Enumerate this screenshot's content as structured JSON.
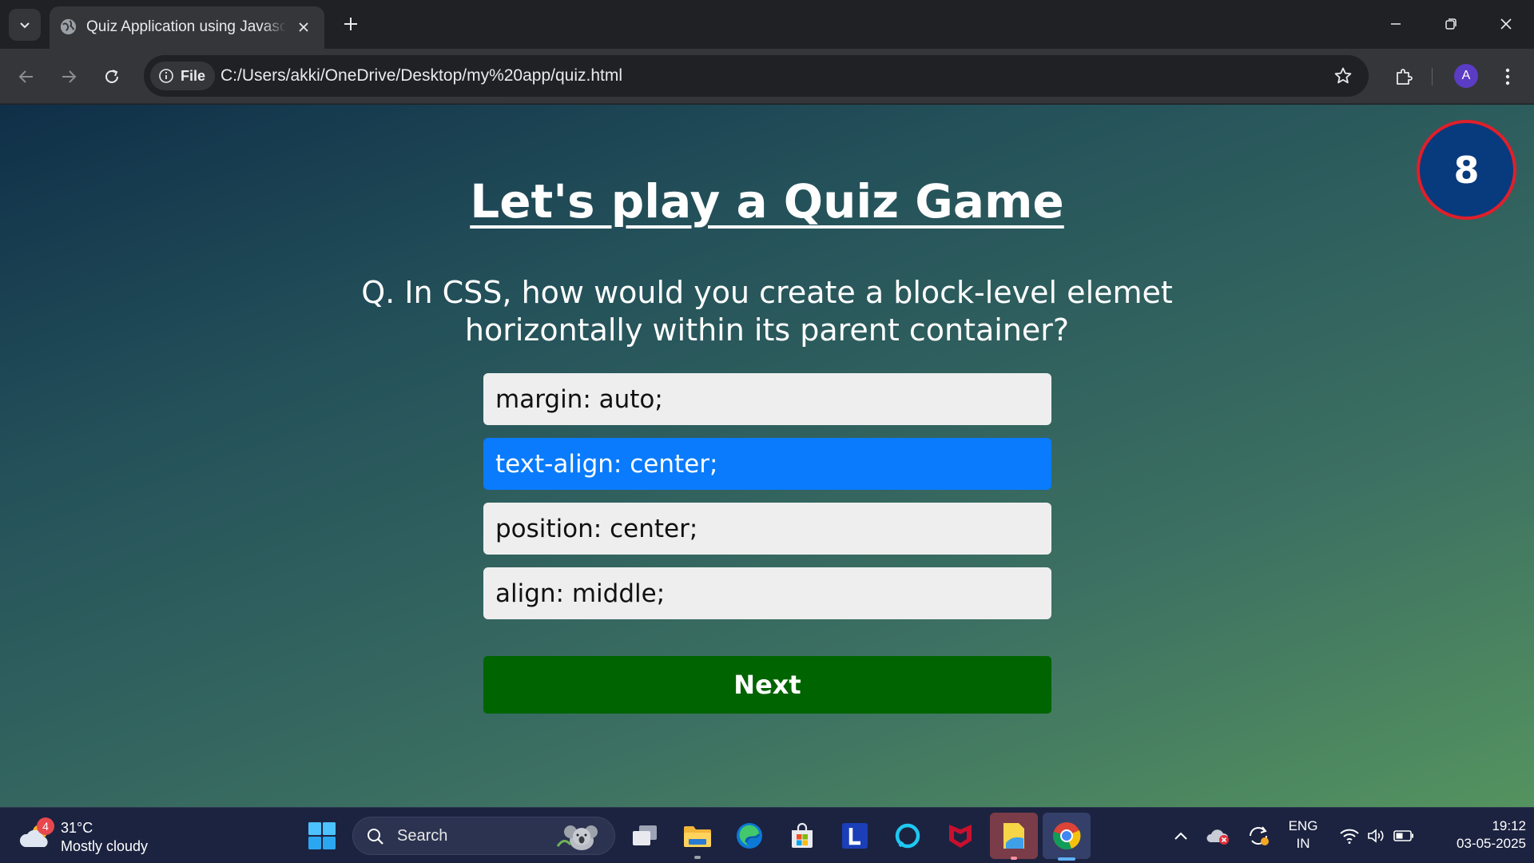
{
  "browser": {
    "tab_title": "Quiz Application using Javascript",
    "site_chip_label": "File",
    "url": "C:/Users/akki/OneDrive/Desktop/my%20app/quiz.html",
    "profile_initial": "A"
  },
  "quiz": {
    "title": "Let's play a Quiz Game",
    "timer": "8",
    "question": "Q. In CSS, how would you create a block-level elemet horizontally within its parent container?",
    "options": [
      {
        "label": "margin: auto;",
        "selected": false
      },
      {
        "label": "text-align: center;",
        "selected": true
      },
      {
        "label": "position: center;",
        "selected": false
      },
      {
        "label": "align: middle;",
        "selected": false
      }
    ],
    "next_label": "Next"
  },
  "taskbar": {
    "weather_temp": "31°C",
    "weather_condition": "Mostly cloudy",
    "weather_badge": "4",
    "search_placeholder": "Search",
    "language_line1": "ENG",
    "language_line2": "IN",
    "time": "19:12",
    "date": "03-05-2025"
  },
  "colors": {
    "selected_option": "#0a7bfc",
    "next_button": "#006400",
    "timer_fill": "#083a7e",
    "timer_border": "#e01f2a"
  }
}
